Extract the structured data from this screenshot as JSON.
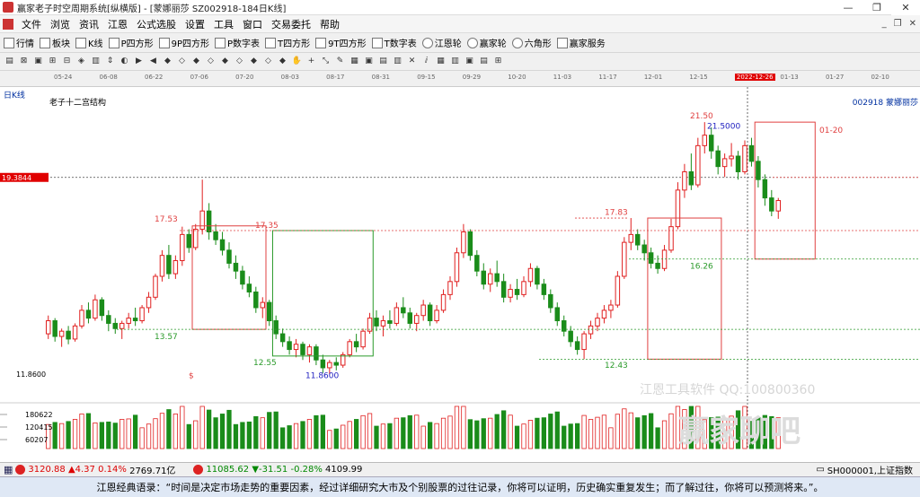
{
  "window": {
    "title": "赢家老子时空周期系统[纵横版] - [蒙娜丽莎  SZ002918-184日K线]"
  },
  "menubar": {
    "items": [
      "文件",
      "浏览",
      "资讯",
      "江恩",
      "公式选股",
      "设置",
      "工具",
      "窗口",
      "交易委托",
      "帮助"
    ]
  },
  "toolbar": {
    "items": [
      {
        "label": "行情",
        "icon": "grid-icon"
      },
      {
        "label": "板块",
        "icon": "blocks-icon"
      },
      {
        "label": "K线",
        "icon": "candle-icon"
      },
      {
        "label": "P四方形",
        "icon": "square-p-icon"
      },
      {
        "label": "9P四方形",
        "icon": "square-9p-icon"
      },
      {
        "label": "P数字表",
        "icon": "table-p-icon"
      },
      {
        "label": "T四方形",
        "icon": "square-t-icon"
      },
      {
        "label": "9T四方形",
        "icon": "square-9t-icon"
      },
      {
        "label": "T数字表",
        "icon": "table-t-icon"
      },
      {
        "label": "江恩轮",
        "icon": "wheel-icon"
      },
      {
        "label": "赢家轮",
        "icon": "winner-wheel-icon"
      },
      {
        "label": "六角形",
        "icon": "hexagon-icon"
      },
      {
        "label": "赢家服务",
        "icon": "service-icon"
      }
    ]
  },
  "chart_data": {
    "type": "candlestick",
    "period_label": "日K线",
    "title": "老子十二宫结构",
    "stock_label": "002918 蒙娜丽莎",
    "date_ticks": [
      "05-24",
      "06-08",
      "06-22",
      "07-06",
      "07-20",
      "08-03",
      "08-17",
      "08-31",
      "09-15",
      "09-29",
      "10-20",
      "11-03",
      "11-17",
      "12-01",
      "12-15",
      "2022-12-26",
      "01-13",
      "01-27",
      "02-10"
    ],
    "highlighted_date": "2022-12-26",
    "cursor_price": "19.3844",
    "price_annotations": [
      "17.53",
      "13.57",
      "17.35",
      "12.55",
      "11.8600",
      "17.83",
      "12.43",
      "21.50",
      "21.5000",
      "16.26",
      "01-20",
      "$"
    ],
    "y_axis_low": "11.8600",
    "volume_ticks": [
      "180622",
      "120415",
      "60207"
    ],
    "ylim": [
      11.0,
      22.5
    ],
    "candles": [
      [
        13.4,
        14.1,
        13.2,
        13.9
      ],
      [
        13.9,
        14.0,
        13.1,
        13.3
      ],
      [
        13.3,
        13.6,
        12.9,
        13.5
      ],
      [
        13.5,
        13.7,
        13.0,
        13.2
      ],
      [
        13.2,
        13.8,
        13.1,
        13.7
      ],
      [
        13.7,
        14.5,
        13.6,
        14.3
      ],
      [
        14.3,
        14.6,
        13.8,
        14.0
      ],
      [
        14.0,
        14.9,
        13.9,
        14.7
      ],
      [
        14.7,
        14.8,
        13.9,
        14.1
      ],
      [
        14.1,
        14.3,
        13.5,
        13.8
      ],
      [
        13.8,
        14.0,
        13.4,
        13.6
      ],
      [
        13.6,
        13.9,
        13.2,
        13.8
      ],
      [
        13.8,
        14.2,
        13.6,
        14.0
      ],
      [
        14.0,
        14.4,
        13.7,
        13.9
      ],
      [
        13.9,
        14.5,
        13.8,
        14.4
      ],
      [
        14.4,
        15.0,
        14.2,
        14.8
      ],
      [
        14.8,
        15.7,
        14.7,
        15.6
      ],
      [
        15.6,
        16.6,
        15.4,
        16.4
      ],
      [
        16.4,
        16.8,
        15.5,
        15.7
      ],
      [
        15.7,
        16.4,
        15.5,
        16.2
      ],
      [
        16.2,
        17.5,
        16.0,
        17.2
      ],
      [
        17.2,
        17.4,
        16.5,
        16.7
      ],
      [
        16.7,
        17.6,
        16.6,
        17.4
      ],
      [
        17.4,
        19.3,
        17.2,
        18.1
      ],
      [
        18.1,
        18.4,
        17.0,
        17.3
      ],
      [
        17.3,
        17.6,
        16.8,
        17.0
      ],
      [
        17.0,
        17.3,
        16.4,
        16.6
      ],
      [
        16.6,
        16.9,
        15.9,
        16.1
      ],
      [
        16.1,
        16.4,
        15.5,
        15.8
      ],
      [
        15.8,
        16.0,
        15.1,
        15.3
      ],
      [
        15.3,
        15.6,
        14.8,
        15.0
      ],
      [
        15.0,
        15.2,
        14.2,
        14.4
      ],
      [
        14.4,
        14.8,
        14.0,
        14.6
      ],
      [
        14.6,
        14.7,
        13.7,
        13.9
      ],
      [
        13.9,
        14.1,
        13.2,
        13.4
      ],
      [
        13.4,
        13.6,
        12.9,
        13.1
      ],
      [
        13.1,
        13.3,
        12.6,
        12.8
      ],
      [
        12.8,
        13.2,
        12.5,
        13.0
      ],
      [
        13.0,
        13.1,
        12.4,
        12.6
      ],
      [
        12.6,
        13.0,
        12.3,
        12.9
      ],
      [
        12.9,
        13.0,
        12.2,
        12.4
      ],
      [
        12.4,
        12.6,
        11.9,
        12.1
      ],
      [
        12.1,
        12.4,
        11.86,
        12.3
      ],
      [
        12.3,
        12.5,
        12.0,
        12.2
      ],
      [
        12.2,
        12.7,
        12.1,
        12.6
      ],
      [
        12.6,
        13.2,
        12.5,
        13.1
      ],
      [
        13.1,
        13.4,
        12.7,
        12.9
      ],
      [
        12.9,
        13.6,
        12.8,
        13.5
      ],
      [
        13.5,
        14.2,
        13.4,
        14.0
      ],
      [
        14.0,
        14.3,
        13.5,
        13.7
      ],
      [
        13.7,
        14.1,
        13.3,
        13.9
      ],
      [
        13.9,
        14.3,
        13.6,
        13.8
      ],
      [
        13.8,
        14.6,
        13.7,
        14.4
      ],
      [
        14.4,
        14.8,
        14.0,
        14.2
      ],
      [
        14.2,
        14.4,
        13.6,
        13.8
      ],
      [
        13.8,
        14.2,
        13.5,
        14.1
      ],
      [
        14.1,
        14.7,
        13.9,
        14.5
      ],
      [
        14.5,
        14.6,
        13.7,
        13.9
      ],
      [
        13.9,
        14.5,
        13.8,
        14.3
      ],
      [
        14.3,
        15.1,
        14.2,
        14.9
      ],
      [
        14.9,
        15.6,
        14.7,
        15.4
      ],
      [
        15.4,
        16.7,
        15.2,
        16.5
      ],
      [
        16.5,
        17.6,
        16.3,
        17.3
      ],
      [
        17.3,
        17.4,
        16.2,
        16.4
      ],
      [
        16.4,
        16.6,
        15.6,
        15.8
      ],
      [
        15.8,
        16.1,
        15.1,
        15.3
      ],
      [
        15.3,
        15.9,
        15.0,
        15.7
      ],
      [
        15.7,
        16.2,
        15.2,
        15.4
      ],
      [
        15.4,
        15.7,
        14.6,
        14.8
      ],
      [
        14.8,
        15.3,
        14.6,
        15.1
      ],
      [
        15.1,
        15.5,
        14.7,
        14.9
      ],
      [
        14.9,
        15.6,
        14.8,
        15.4
      ],
      [
        15.4,
        16.1,
        15.2,
        15.9
      ],
      [
        15.9,
        16.0,
        15.1,
        15.3
      ],
      [
        15.3,
        15.5,
        14.7,
        14.9
      ],
      [
        14.9,
        15.1,
        14.2,
        14.4
      ],
      [
        14.4,
        14.6,
        13.7,
        13.9
      ],
      [
        13.9,
        14.1,
        13.3,
        13.5
      ],
      [
        13.5,
        13.7,
        12.9,
        13.1
      ],
      [
        13.1,
        13.3,
        12.6,
        12.8
      ],
      [
        12.8,
        13.5,
        12.43,
        13.4
      ],
      [
        13.4,
        13.9,
        13.2,
        13.7
      ],
      [
        13.7,
        14.2,
        13.5,
        14.0
      ],
      [
        14.0,
        14.5,
        13.8,
        14.3
      ],
      [
        14.3,
        14.7,
        14.0,
        14.5
      ],
      [
        14.5,
        15.8,
        14.4,
        15.6
      ],
      [
        15.6,
        17.1,
        15.5,
        16.9
      ],
      [
        16.9,
        17.83,
        16.6,
        17.2
      ],
      [
        17.2,
        17.4,
        16.6,
        16.8
      ],
      [
        16.8,
        17.0,
        16.2,
        16.5
      ],
      [
        16.5,
        16.7,
        15.9,
        16.1
      ],
      [
        16.1,
        16.4,
        15.7,
        15.9
      ],
      [
        15.9,
        16.8,
        15.8,
        16.6
      ],
      [
        16.6,
        17.8,
        16.5,
        17.5
      ],
      [
        17.5,
        19.2,
        17.4,
        18.9
      ],
      [
        18.9,
        19.9,
        18.6,
        19.6
      ],
      [
        19.6,
        20.3,
        18.9,
        19.1
      ],
      [
        19.1,
        20.9,
        19.0,
        20.6
      ],
      [
        20.6,
        21.5,
        20.3,
        21.0
      ],
      [
        21.0,
        21.3,
        20.1,
        20.4
      ],
      [
        20.4,
        20.6,
        19.5,
        19.8
      ],
      [
        19.8,
        20.3,
        19.4,
        20.1
      ],
      [
        20.1,
        20.7,
        19.8,
        20.2
      ],
      [
        20.2,
        20.4,
        19.3,
        19.6
      ],
      [
        19.6,
        20.8,
        19.5,
        20.6
      ],
      [
        20.6,
        20.9,
        19.8,
        20.0
      ],
      [
        20.0,
        20.2,
        19.0,
        19.3
      ],
      [
        19.3,
        19.5,
        18.3,
        18.6
      ],
      [
        18.6,
        18.9,
        17.9,
        18.1
      ],
      [
        18.1,
        18.6,
        17.8,
        18.5
      ]
    ]
  },
  "statusbar": {
    "sh_index": "3120.88",
    "sh_change": "▲4.37",
    "sh_pct": "0.14%",
    "sh_amount": "2769.71亿",
    "sz_index": "11085.62",
    "sz_change": "▼-31.51",
    "sz_pct": "-0.28%",
    "sz_amount": "4109.99",
    "right_label": "SH000001,上证指数"
  },
  "watermark": {
    "line1": "江恩工具软件  QQ:100800360",
    "line2": "赢家聊吧"
  },
  "quote": {
    "text": "江恩经典语录：“时间是决定市场走势的重要因素，经过详细研究大市及个别股票的过往记录，你将可以证明，历史确实重复发生；而了解过往，你将可以预测将来。”。"
  },
  "colors": {
    "up": "#e02020",
    "down": "#1a8c1a",
    "box": "#e04040",
    "box2": "#2a9a2a",
    "cursor_bg": "#e00000"
  }
}
